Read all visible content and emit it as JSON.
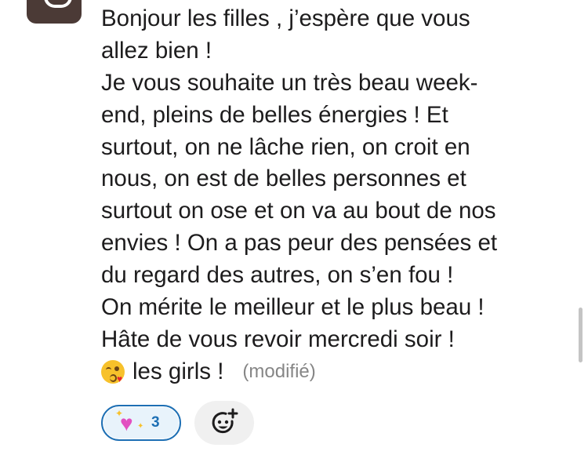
{
  "message": {
    "lines": [
      "Bonjour les filles , j’espère que vous",
      "allez bien !",
      "Je vous souhaite un très beau week-",
      "end, pleins de belles énergies ! Et",
      "surtout, on ne lâche rien,  on croit en",
      "nous, on est de belles personnes et",
      "surtout on ose et on va au bout de nos",
      "envies ! On a pas peur des pensées et",
      "du regard des autres, on s’en fou !",
      "On mérite le meilleur et le plus beau !",
      "Hâte de vous revoir mercredi soir !"
    ],
    "last_line_emoji": "face-blowing-a-kiss-icon",
    "last_line_text": "les girls !",
    "edited_label": "(modifié)"
  },
  "reactions": [
    {
      "emoji": "sparkling-heart-icon",
      "count": "3",
      "selected": true
    }
  ],
  "add_reaction_icon": "add-reaction-icon",
  "colors": {
    "reaction_border": "#1d6fb4",
    "reaction_bg": "#e8f3fb",
    "edited_text": "#868686",
    "avatar_bg": "#4b3a36"
  }
}
